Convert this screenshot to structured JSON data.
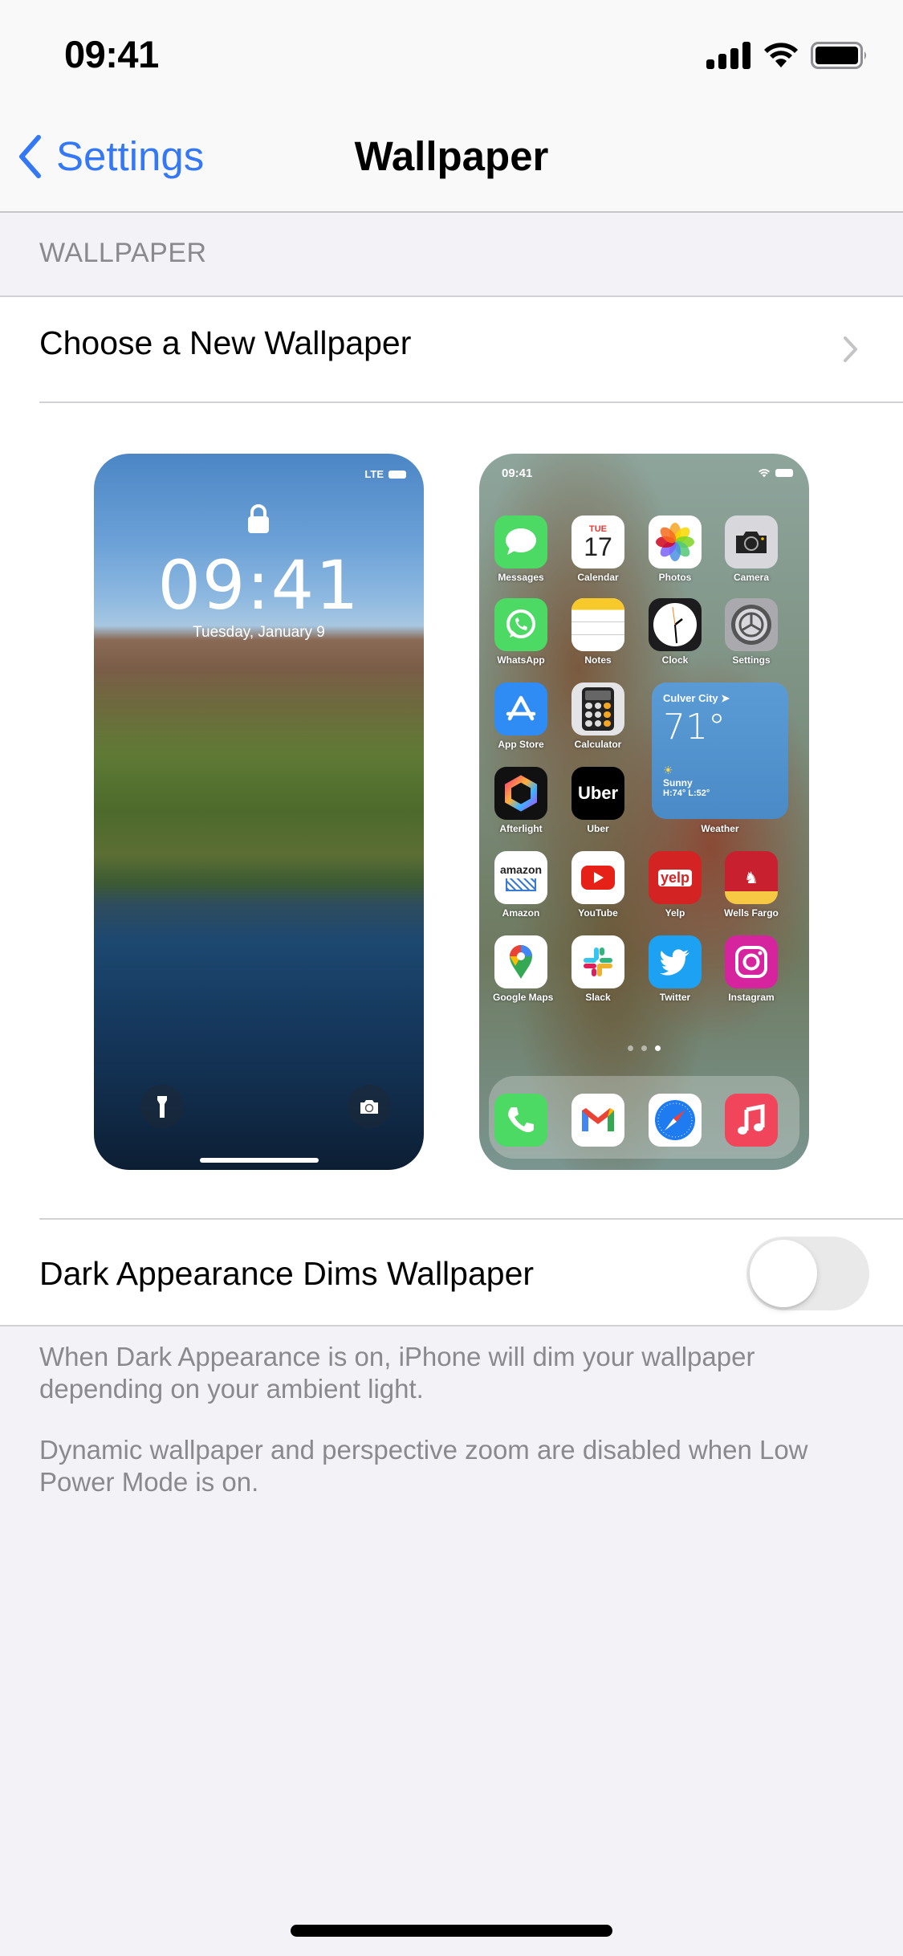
{
  "status_bar": {
    "time": "09:41",
    "icons": [
      "cellular-signal-icon",
      "wifi-icon",
      "battery-icon"
    ]
  },
  "nav": {
    "back_label": "Settings",
    "title": "Wallpaper"
  },
  "section": {
    "header": "WALLPAPER",
    "choose_label": "Choose a New Wallpaper"
  },
  "lock_preview": {
    "carrier": "LTE",
    "time": "09:41",
    "date": "Tuesday, January 9"
  },
  "home_preview": {
    "time": "09:41",
    "apps": [
      {
        "label": "Messages",
        "icon": "messages-icon",
        "color": "#4cd964"
      },
      {
        "label": "Calendar",
        "icon": "calendar-icon",
        "color": "#ffffff",
        "day": "TUE",
        "date": "17"
      },
      {
        "label": "Photos",
        "icon": "photos-icon",
        "color": "#ffffff"
      },
      {
        "label": "Camera",
        "icon": "camera-icon",
        "color": "#d8d8dc"
      },
      {
        "label": "WhatsApp",
        "icon": "whatsapp-icon",
        "color": "#4cd964"
      },
      {
        "label": "Notes",
        "icon": "notes-icon",
        "color": "#ffffff"
      },
      {
        "label": "Clock",
        "icon": "clock-icon",
        "color": "#1c1c1e"
      },
      {
        "label": "Settings",
        "icon": "settings-icon",
        "color": "#a9a9ae"
      },
      {
        "label": "App Store",
        "icon": "app-store-icon",
        "color": "#2f8cf5"
      },
      {
        "label": "Calculator",
        "icon": "calculator-icon",
        "color": "#e4e4e6"
      },
      {
        "label": "Afterlight",
        "icon": "afterlight-icon",
        "color": "#111111"
      },
      {
        "label": "Uber",
        "icon": "uber-icon",
        "color": "#000000"
      },
      {
        "label": "Amazon",
        "icon": "amazon-icon",
        "color": "#ffffff"
      },
      {
        "label": "YouTube",
        "icon": "youtube-icon",
        "color": "#ffffff"
      },
      {
        "label": "Yelp",
        "icon": "yelp-icon",
        "color": "#d32323"
      },
      {
        "label": "Wells Fargo",
        "icon": "wells-fargo-icon",
        "color": "#c8202f"
      },
      {
        "label": "Google Maps",
        "icon": "google-maps-icon",
        "color": "#ffffff"
      },
      {
        "label": "Slack",
        "icon": "slack-icon",
        "color": "#ffffff"
      },
      {
        "label": "Twitter",
        "icon": "twitter-icon",
        "color": "#1da1f2"
      },
      {
        "label": "Instagram",
        "icon": "instagram-icon",
        "color": "#d6249f"
      }
    ],
    "weather": {
      "city": "Culver City",
      "temp": "71°",
      "condition": "Sunny",
      "high_low": "H:74° L:52°",
      "label": "Weather"
    },
    "page_count": 3,
    "active_page": 3,
    "dock": [
      {
        "name": "Phone",
        "icon": "phone-icon",
        "color": "#4cd964"
      },
      {
        "name": "Gmail",
        "icon": "gmail-icon",
        "color": "#ffffff"
      },
      {
        "name": "Safari",
        "icon": "safari-icon",
        "color": "#ffffff"
      },
      {
        "name": "Music",
        "icon": "music-icon",
        "color": "#f0455a"
      }
    ]
  },
  "dark_setting": {
    "label": "Dark Appearance Dims Wallpaper",
    "enabled": false
  },
  "footer": {
    "note1": "When Dark Appearance is on, iPhone will dim your wallpaper depending on your ambient light.",
    "note2": "Dynamic wallpaper and perspective zoom are disabled when Low Power Mode is on."
  },
  "colors": {
    "accent": "#3478f6",
    "background": "#f2f2f7",
    "secondary_text": "#8a8a8e",
    "toggle_off": "#e9e9ea"
  }
}
